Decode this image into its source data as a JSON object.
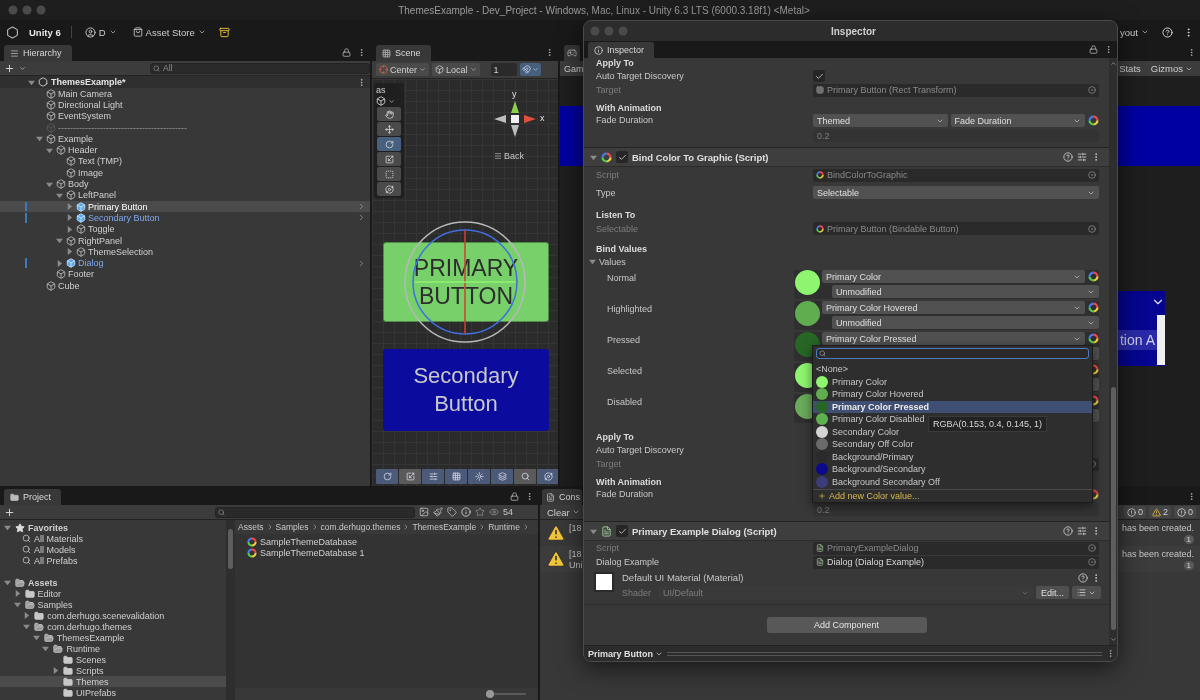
{
  "window": {
    "title": "ThemesExample - Dev_Project - Windows, Mac, Linux - Unity 6.3 LTS (6000.3.18f1) <Metal>"
  },
  "toolbar": {
    "product": "Unity 6",
    "account": "D",
    "store": "Asset Store",
    "layout": "yout"
  },
  "hierarchy": {
    "tab": "Hierarchy",
    "search_placeholder": "All",
    "scene": {
      "name": "ThemesExample*",
      "expanded": true
    },
    "items": [
      {
        "name": "Main Camera",
        "kind": "object",
        "selected": false
      },
      {
        "name": "Directional Light",
        "kind": "object",
        "selected": false
      },
      {
        "name": "EventSystem",
        "kind": "object",
        "selected": false
      },
      {
        "name": "-------------------------------------------",
        "kind": "separator",
        "selected": false
      },
      {
        "name": "Example",
        "kind": "object",
        "selected": false,
        "expanded": true,
        "children": [
          {
            "name": "Header",
            "kind": "object",
            "selected": false,
            "expanded": true,
            "children": [
              {
                "name": "Text (TMP)",
                "kind": "object",
                "selected": false
              },
              {
                "name": "Image",
                "kind": "object",
                "selected": false
              }
            ]
          },
          {
            "name": "Body",
            "kind": "object",
            "selected": false,
            "expanded": true,
            "children": [
              {
                "name": "LeftPanel",
                "kind": "object",
                "selected": false,
                "expanded": true,
                "children": [
                  {
                    "name": "Primary Button",
                    "kind": "prefab",
                    "selected": true,
                    "expanded": false
                  },
                  {
                    "name": "Secondary Button",
                    "kind": "prefab",
                    "selected": false,
                    "expanded": false
                  },
                  {
                    "name": "Toggle",
                    "kind": "object",
                    "selected": false,
                    "expanded": false
                  }
                ]
              },
              {
                "name": "RightPanel",
                "kind": "object",
                "selected": false,
                "expanded": true,
                "children": [
                  {
                    "name": "ThemeSelection",
                    "kind": "object",
                    "selected": false,
                    "expanded": false
                  }
                ]
              },
              {
                "name": "Dialog",
                "kind": "prefab",
                "selected": false,
                "expanded": false
              }
            ]
          },
          {
            "name": "Footer",
            "kind": "object",
            "selected": false
          }
        ]
      },
      {
        "name": "Cube",
        "kind": "object",
        "selected": false
      }
    ]
  },
  "scene_view": {
    "tab": "Scene",
    "pivot": "Center",
    "space": "Local",
    "grid_value": "1",
    "overlay_label": "as",
    "tools": [
      {
        "kind": "hand",
        "selected": false
      },
      {
        "kind": "move",
        "selected": false
      },
      {
        "kind": "rotate",
        "selected": true
      },
      {
        "kind": "scale",
        "selected": false
      },
      {
        "kind": "rect",
        "selected": false
      },
      {
        "kind": "transform",
        "selected": false
      }
    ],
    "axis_y": "y",
    "axis_x": "x",
    "view_label": "Back",
    "primary_button": "PRIMARY BUTTON",
    "secondary_button": "Secondary Button"
  },
  "game_view": {
    "display": "Gam",
    "stats": "Stats",
    "gizmos": "Gizmos",
    "dropdown_text": "tion A"
  },
  "project": {
    "tab": "Project",
    "visible_count": "54",
    "favorites": {
      "label": "Favorites",
      "expanded": true,
      "items": [
        "All Materials",
        "All Models",
        "All Prefabs"
      ]
    },
    "assets": {
      "name": "Assets",
      "selected": false,
      "expanded": true,
      "children": [
        {
          "name": "Editor",
          "selected": false,
          "expanded": false
        },
        {
          "name": "Samples",
          "selected": false,
          "expanded": true,
          "children": [
            {
              "name": "com.derhugo.scenevalidation",
              "selected": false,
              "expanded": false
            },
            {
              "name": "com.derhugo.themes",
              "selected": false,
              "expanded": true,
              "children": [
                {
                  "name": "ThemesExample",
                  "selected": false,
                  "expanded": true,
                  "children": [
                    {
                      "name": "Runtime",
                      "selected": false,
                      "expanded": true,
                      "children": [
                        {
                          "name": "Scenes",
                          "selected": false
                        },
                        {
                          "name": "Scripts",
                          "selected": false,
                          "expanded": false
                        },
                        {
                          "name": "Themes",
                          "selected": true
                        },
                        {
                          "name": "UIPrefabs",
                          "selected": false
                        }
                      ]
                    }
                  ]
                }
              ]
            }
          ]
        }
      ]
    },
    "breadcrumb": [
      "Assets",
      "Samples",
      "com.derhugo.themes",
      "ThemesExample",
      "Runtime"
    ],
    "files": [
      "SampleThemeDatabase",
      "SampleThemeDatabase 1"
    ],
    "zoom_slider": {
      "level": 0
    }
  },
  "console": {
    "tab": "Cons",
    "clear": "Clear",
    "counts": [
      {
        "kind": "info",
        "value": "0"
      },
      {
        "kind": "warning",
        "value": "2"
      },
      {
        "kind": "error",
        "value": "0"
      }
    ],
    "entries": [
      {
        "prefix": "[18",
        "message": "has been created.",
        "count": "1"
      },
      {
        "prefix": "[18",
        "line_2": "Uni",
        "message": "has been created.",
        "count": "1"
      }
    ]
  },
  "inspector": {
    "title": "Inspector",
    "tab": "Inspector",
    "rows": [
      {
        "kind": "header",
        "label": "Apply To"
      },
      {
        "kind": "toggle",
        "label": "Auto Target Discovery",
        "checked": true
      },
      {
        "kind": "object",
        "label": "Target",
        "value": "Primary Button (Rect Transform)",
        "disabled": true
      },
      {
        "kind": "header",
        "label": "With Animation"
      },
      {
        "kind": "themed",
        "label": "Fade Duration",
        "options": [
          "Themed",
          "Fade Duration"
        ],
        "value": "0.2"
      },
      {
        "kind": "component",
        "label": "Bind Color To Graphic (Script)",
        "enabled": true,
        "expanded": true
      },
      {
        "kind": "object",
        "label": "Script",
        "value": "BindColorToGraphic",
        "disabled": true
      },
      {
        "kind": "dropdown",
        "label": "Type",
        "value": "Selectable"
      },
      {
        "kind": "header",
        "label": "Listen To"
      },
      {
        "kind": "object",
        "label": "Selectable",
        "value": "Primary Button (Bindable Button)",
        "disabled": true
      },
      {
        "kind": "header",
        "label": "Bind Values"
      },
      {
        "kind": "foldout",
        "label": "Values",
        "expanded": true
      },
      {
        "kind": "color",
        "label": "Normal",
        "color": "#8ef56f",
        "primary": "Primary Color",
        "secondary": "Unmodified"
      },
      {
        "kind": "color",
        "label": "Highlighted",
        "color": "#5fad4e",
        "primary": "Primary Color Hovered",
        "secondary": "Unmodified"
      },
      {
        "kind": "color",
        "label": "Pressed",
        "color": "#276625",
        "primary": "Primary Color Pressed"
      },
      {
        "kind": "color",
        "label": "Selected",
        "color": "#8ef56f"
      },
      {
        "kind": "color",
        "label": "Disabled",
        "color": "#6aab5c"
      },
      {
        "kind": "header",
        "label": "Apply To"
      },
      {
        "kind": "toggle",
        "label": "Auto Target Discovery"
      },
      {
        "kind": "object",
        "label": "Target",
        "disabled": true
      },
      {
        "kind": "header",
        "label": "With Animation"
      },
      {
        "kind": "themed",
        "label": "Fade Duration",
        "value": "0.2"
      },
      {
        "kind": "component",
        "label": "Primary Example Dialog (Script)",
        "enabled": true,
        "expanded": true
      },
      {
        "kind": "object",
        "label": "Script",
        "value": "PrimaryExampleDialog",
        "disabled": true
      },
      {
        "kind": "object",
        "label": "Dialog Example",
        "value": "Dialog (Dialog Example)",
        "disabled": false
      },
      {
        "kind": "material",
        "label": "Default UI Material (Material)",
        "shader_label": "Shader",
        "shader": "UI/Default",
        "button": "Edit..."
      },
      {
        "kind": "add",
        "label": "Add Component"
      }
    ],
    "footer": "Primary Button",
    "popup": {
      "items": [
        {
          "label": "<None>",
          "selected": false
        },
        {
          "label": "Primary Color",
          "color": "#8ef56f",
          "selected": false
        },
        {
          "label": "Primary Color Hovered",
          "color": "#5fad4e",
          "selected": false
        },
        {
          "label": "Primary Color Pressed",
          "color": "#276625",
          "selected": true
        },
        {
          "label": "Primary Color Disabled",
          "color": "#5fb04f",
          "selected": false
        },
        {
          "label": "Secondary Color",
          "color": "#d4d4d4",
          "selected": false
        },
        {
          "label": "Secondary Off Color",
          "color": "#6a6a6a",
          "selected": false
        },
        {
          "label": "Background/Primary",
          "color": "#2a2a2a",
          "selected": false
        },
        {
          "label": "Background/Secondary",
          "color": "#0a0a8a",
          "selected": false
        },
        {
          "label": "Background Secondary Off",
          "color": "#3c3c7a",
          "selected": false
        }
      ],
      "add": "Add new Color value...",
      "tooltip": "RGBA(0.153, 0.4, 0.145, 1)"
    }
  }
}
